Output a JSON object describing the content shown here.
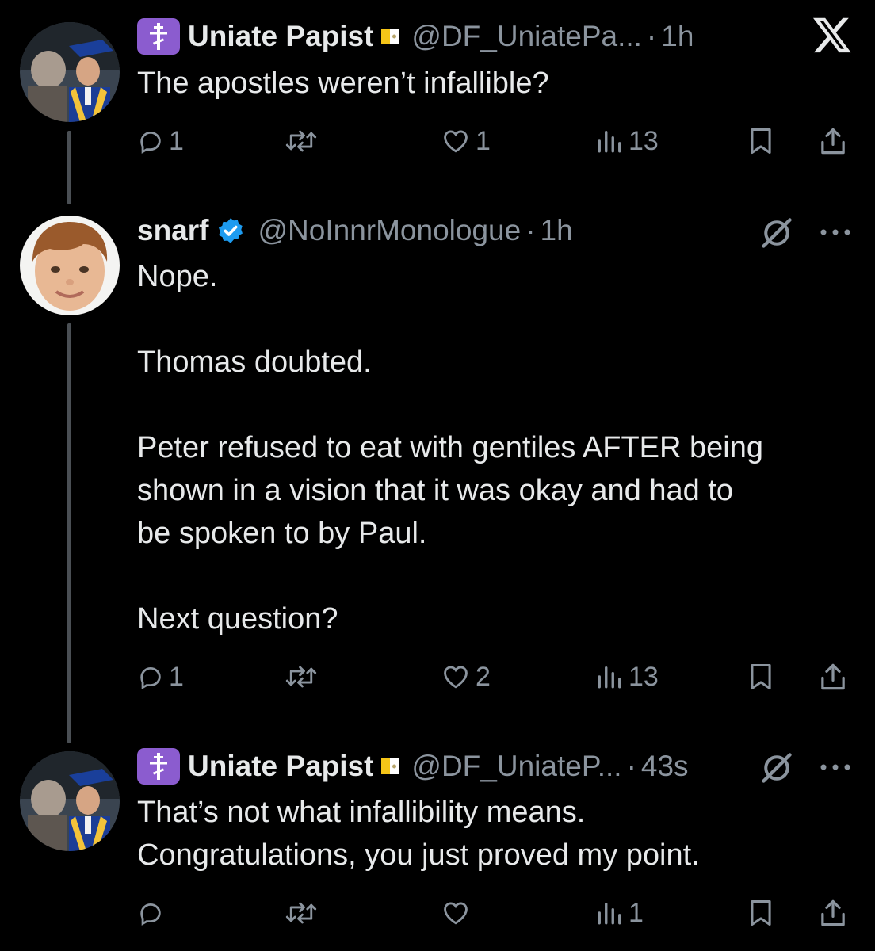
{
  "tweets": [
    {
      "name": "Uniate Papist",
      "handle": "@DF_UniatePa...",
      "sep": "·",
      "time": "1h",
      "text": "The apostles weren’t infallible?",
      "replies": "1",
      "retweets": "",
      "likes": "1",
      "views": "13"
    },
    {
      "name": "snarf",
      "handle": "@NoInnrMonologue",
      "sep": "·",
      "time": "1h",
      "text": "Nope.\n\nThomas doubted.\n\nPeter refused to eat with gentiles AFTER being\nshown in a vision that it was okay and had to\nbe spoken to by Paul.\n\nNext question?",
      "replies": "1",
      "retweets": "",
      "likes": "2",
      "views": "13"
    },
    {
      "name": "Uniate Papist",
      "handle": "@DF_UniateP...",
      "sep": "·",
      "time": "43s",
      "text": "That’s not what infallibility means.\nCongratulations, you just proved my point.",
      "replies": "",
      "retweets": "",
      "likes": "",
      "views": "1"
    }
  ],
  "colors": {
    "background": "#000000",
    "text": "#e7e9ea",
    "muted": "#8b949e",
    "badge": "#8b5ccf",
    "verified": "#1d9bf0"
  },
  "icons": [
    "x-logo-icon",
    "orthodox-cross-icon",
    "vatican-flag-icon",
    "verified-badge-icon",
    "grok-icon",
    "more-icon",
    "reply-icon",
    "retweet-icon",
    "like-icon",
    "views-icon",
    "bookmark-icon",
    "share-icon"
  ]
}
